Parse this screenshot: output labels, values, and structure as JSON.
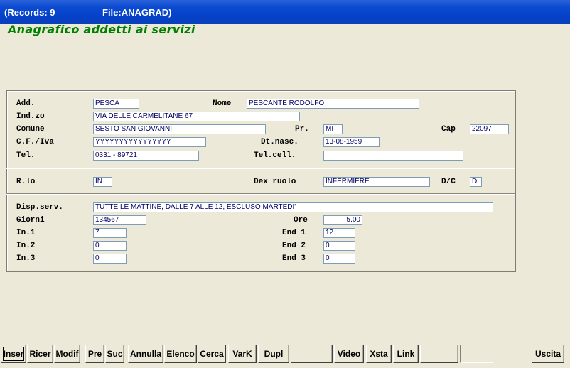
{
  "titlebar": {
    "records": "(Records: 9",
    "file": "File:ANAGRAD)"
  },
  "form_title": "Anagrafico addetti ai servizi",
  "fields": {
    "add": {
      "label": "Add.",
      "value": "PESCA"
    },
    "nome": {
      "label": "Nome",
      "value": "PESCANTE RODOLFO"
    },
    "indzo": {
      "label": "Ind.zo",
      "value": "VIA DELLE CARMELITANE 67"
    },
    "comune": {
      "label": "Comune",
      "value": "SESTO SAN GIOVANNI"
    },
    "pr": {
      "label": "Pr.",
      "value": "MI"
    },
    "cap": {
      "label": "Cap",
      "value": "22097"
    },
    "cfiva": {
      "label": "C.F./Iva",
      "value": "YYYYYYYYYYYYYYYY"
    },
    "dtnasc": {
      "label": "Dt.nasc.",
      "value": "13-08-1959"
    },
    "tel": {
      "label": "Tel.",
      "value": "0331 - 89721"
    },
    "telcell": {
      "label": "Tel.cell.",
      "value": ""
    },
    "rlo": {
      "label": "R.lo",
      "value": "IN"
    },
    "dexruolo": {
      "label": "Dex ruolo",
      "value": "INFERMIERE"
    },
    "dc": {
      "label": "D/C",
      "value": "D"
    },
    "dispserv": {
      "label": "Disp.serv.",
      "value": "TUTTE LE MATTINE, DALLE 7 ALLE 12, ESCLUSO MARTEDI'"
    },
    "giorni": {
      "label": "Giorni",
      "value": "134567"
    },
    "ore": {
      "label": "Ore",
      "value": "5.00"
    },
    "in1": {
      "label": "In.1",
      "value": "7"
    },
    "end1": {
      "label": "End 1",
      "value": "12"
    },
    "in2": {
      "label": "In.2",
      "value": "0"
    },
    "end2": {
      "label": "End 2",
      "value": "0"
    },
    "in3": {
      "label": "In.3",
      "value": "0"
    },
    "end3": {
      "label": "End 3",
      "value": "0"
    }
  },
  "toolbar": {
    "inser": "Inser",
    "ricer": "Ricer",
    "modif": "Modif",
    "pre": "Pre",
    "suc": "Suc",
    "annulla": "Annulla",
    "elenco": "Elenco",
    "cerca": "Cerca",
    "vark": "VarK",
    "dupl": "Dupl",
    "blank1": "",
    "video": "Video",
    "xsta": "Xsta",
    "link": "Link",
    "blank2": "",
    "blank3": "",
    "uscita": "Uscita"
  }
}
